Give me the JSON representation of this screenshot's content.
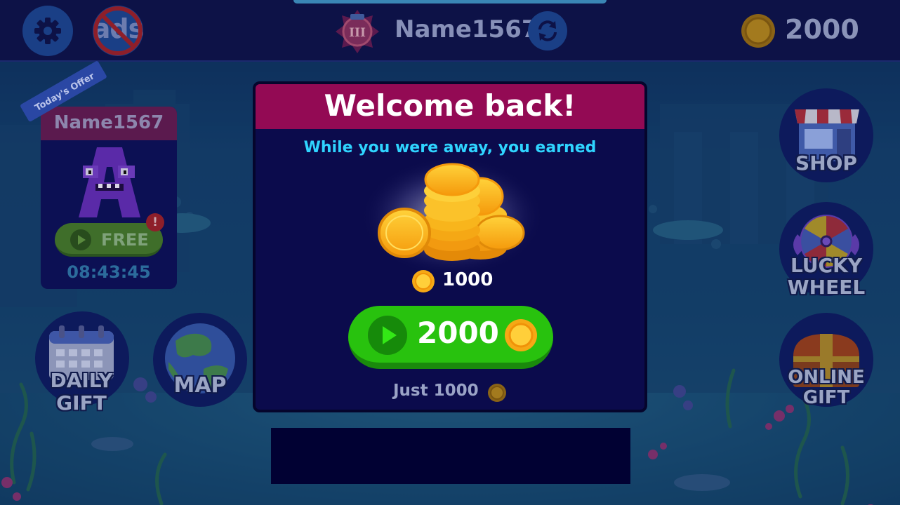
{
  "topbar": {
    "settings_icon": "gear-icon",
    "no_ads_text": "ads",
    "rank_numeral": "III",
    "player_name": "Name1567",
    "sync_icon": "refresh-icon",
    "coin_count": "2000"
  },
  "offer": {
    "ribbon": "Today's Offer",
    "name": "Name1567",
    "free_label": "FREE",
    "alert": "!",
    "timer": "08:43:45"
  },
  "side_buttons": {
    "daily_gift": [
      "DAILY",
      "GIFT"
    ],
    "map": "MAP",
    "shop": "SHOP",
    "lucky_wheel": [
      "LUCKY",
      "WHEEL"
    ],
    "online_gift": [
      "ONLINE",
      "GIFT"
    ]
  },
  "modal": {
    "title": "Welcome back!",
    "subtitle": "While you were away, you earned",
    "earned_value": "1000",
    "claim_value": "2000",
    "just_label": "Just 1000"
  },
  "colors": {
    "modal_header": "#930a54",
    "subtitle": "#2fd4ff",
    "claim_button": "#28c20e",
    "coin": "#f5b21a"
  }
}
